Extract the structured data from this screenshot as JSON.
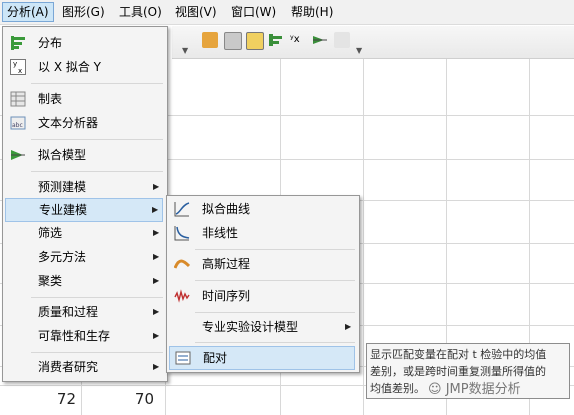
{
  "menubar": {
    "items": [
      {
        "label": "分析(A)"
      },
      {
        "label": "图形(G)"
      },
      {
        "label": "工具(O)"
      },
      {
        "label": "视图(V)"
      },
      {
        "label": "窗口(W)"
      },
      {
        "label": "帮助(H)"
      }
    ]
  },
  "analyze_menu": {
    "items": [
      {
        "label": "分布",
        "icon": "distribution-icon"
      },
      {
        "label": "以 X 拟合 Y",
        "icon": "fit-y-by-x-icon"
      },
      {
        "label": "制表",
        "icon": "tabulate-icon"
      },
      {
        "label": "文本分析器",
        "icon": "text-explorer-icon"
      },
      {
        "label": "拟合模型",
        "icon": "fit-model-icon"
      },
      {
        "label": "预测建模",
        "submenu": true
      },
      {
        "label": "专业建模",
        "submenu": true,
        "highlighted": true
      },
      {
        "label": "筛选",
        "submenu": true
      },
      {
        "label": "多元方法",
        "submenu": true
      },
      {
        "label": "聚类",
        "submenu": true
      },
      {
        "label": "质量和过程",
        "submenu": true
      },
      {
        "label": "可靠性和生存",
        "submenu": true
      },
      {
        "label": "消费者研究",
        "submenu": true
      }
    ]
  },
  "specialized_menu": {
    "items": [
      {
        "label": "拟合曲线",
        "icon": "fit-curve-icon"
      },
      {
        "label": "非线性",
        "icon": "nonlinear-icon"
      },
      {
        "label": "高斯过程",
        "icon": "gaussian-process-icon"
      },
      {
        "label": "时间序列",
        "icon": "time-series-icon"
      },
      {
        "label": "专业实验设计模型",
        "submenu": true
      },
      {
        "label": "配对",
        "icon": "matched-pairs-icon",
        "highlighted": true
      }
    ]
  },
  "tooltip": {
    "lines": [
      "显示匹配变量在配对 t 检验中的均值",
      "差别，或是跨时间重复测量所得值的",
      "均值差别。"
    ]
  },
  "grid": {
    "cells": [
      {
        "value": "72"
      },
      {
        "value": "70"
      }
    ]
  },
  "watermark": {
    "text": "JMP数据分析"
  },
  "colors": {
    "highlight": "#d5e8f7",
    "menu_bg": "#f4f4f4"
  }
}
